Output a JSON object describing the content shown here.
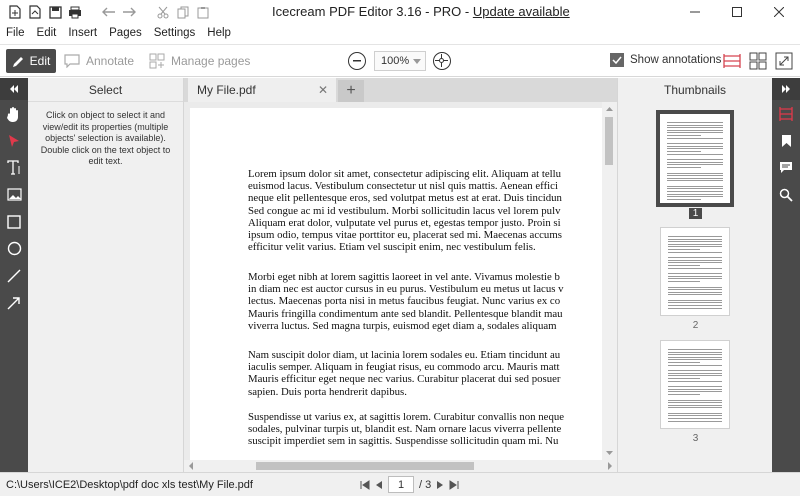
{
  "window": {
    "app_title": "Icecream PDF Editor 3.16 - PRO - ",
    "update_link": "Update available"
  },
  "quick_access": [
    "new-file-icon",
    "open-file-icon",
    "save-icon",
    "print-icon",
    "undo-icon",
    "redo-icon",
    "cut-icon",
    "copy-icon",
    "paste-icon"
  ],
  "menu": [
    "File",
    "Edit",
    "Insert",
    "Pages",
    "Settings",
    "Help"
  ],
  "toolbar": {
    "edit_label": "Edit",
    "annotate_label": "Annotate",
    "manage_pages_label": "Manage pages",
    "zoom_value": "100%",
    "show_annotations_label": "Show annotations",
    "show_annotations_checked": true
  },
  "select_panel": {
    "title": "Select",
    "help_text": "Click on object to select it and view/edit its properties (multiple objects' selection is available). Double click on the text object to edit text."
  },
  "tabs": [
    {
      "label": "My File.pdf"
    }
  ],
  "document": {
    "paragraphs": [
      [
        "Lorem ipsum dolor sit amet, consectetur adipiscing elit. Aliquam at tellu",
        "euismod lacus. Vestibulum consectetur ut nisl quis mattis. Aenean effici",
        "neque elit pellentesque eros, sed volutpat metus est at erat. Duis tincidun",
        "Sed congue ac mi id vestibulum. Morbi sollicitudin lacus vel lorem pulv",
        "Aliquam erat dolor, vulputate vel purus et, egestas tempor justo. Proin si",
        "ipsum odio, tempus vitae porttitor eu, placerat sed mi. Maecenas accums",
        "efficitur velit varius. Etiam vel suscipit enim, nec vestibulum felis."
      ],
      [
        "Morbi eget nibh at lorem sagittis laoreet in vel ante. Vivamus molestie b",
        "in diam nec est auctor cursus in eu purus. Vestibulum eu metus ut lacus v",
        "lectus. Maecenas porta nisi in metus faucibus feugiat. Nunc varius ex co",
        "Mauris fringilla condimentum ante sed blandit. Pellentesque blandit mau",
        "viverra luctus. Sed magna turpis, euismod eget diam a, sodales aliquam"
      ],
      [
        "Nam suscipit dolor diam, ut lacinia lorem sodales eu. Etiam tincidunt au",
        "iaculis semper. Aliquam in feugiat risus, eu commodo arcu. Mauris matt",
        "Mauris efficitur eget neque nec varius. Curabitur placerat dui sed posuer",
        "sapien. Duis porta hendrerit dapibus."
      ],
      [
        "Suspendisse ut varius ex, at sagittis lorem. Curabitur convallis non neque",
        "sodales, pulvinar turpis ut, blandit est. Nam ornare lacus viverra pellente",
        "suscipit imperdiet sem in sagittis. Suspendisse sollicitudin quam mi. Nu"
      ]
    ]
  },
  "thumbnails": {
    "title": "Thumbnails",
    "pages": [
      {
        "number": "1",
        "selected": true
      },
      {
        "number": "2",
        "selected": false
      },
      {
        "number": "3",
        "selected": false
      }
    ]
  },
  "status": {
    "file_path": "C:\\Users\\ICE2\\Desktop\\pdf doc xls test\\My File.pdf",
    "current_page": "1",
    "total_pages": "/ 3"
  }
}
